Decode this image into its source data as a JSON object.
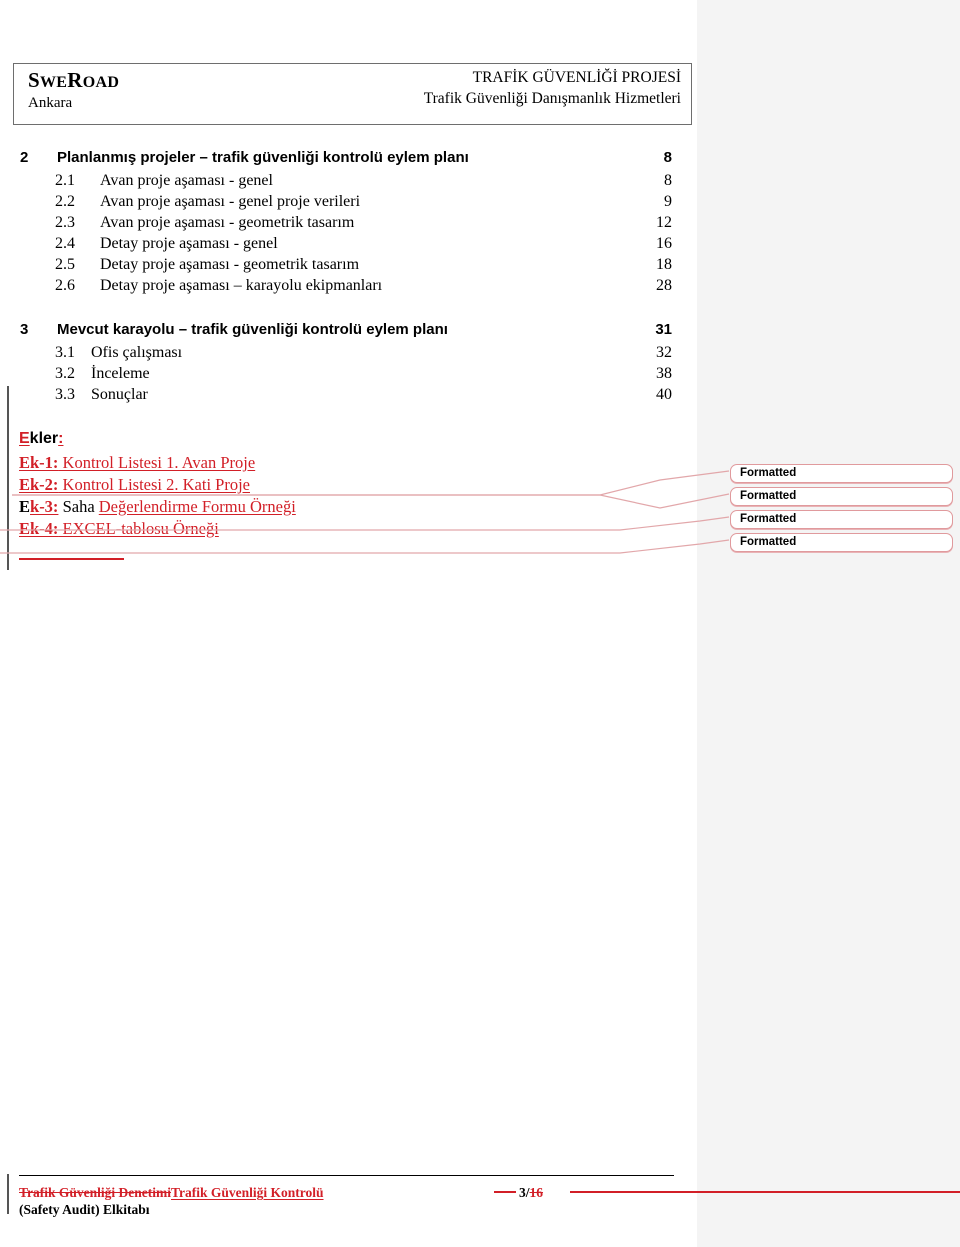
{
  "header": {
    "brand_lead": "S",
    "brand_rest_1": "WE",
    "brand_lead_2": "R",
    "brand_rest_2": "OAD",
    "city": "Ankara",
    "project_title": "TRAFİK GÜVENLİĞİ PROJESİ",
    "project_subtitle": "Trafik Güvenliği Danışmanlık Hizmetleri"
  },
  "toc": {
    "sections": [
      {
        "number": "2",
        "label": "Planlanmış projeler – trafik güvenliği kontrolü eylem planı",
        "page": "8",
        "entries": [
          {
            "number": "2.1",
            "label": "Avan proje aşaması - genel",
            "page": "8"
          },
          {
            "number": "2.2",
            "label": "Avan proje aşaması - genel proje verileri",
            "page": "9"
          },
          {
            "number": "2.3",
            "label": "Avan proje aşaması - geometrik tasarım",
            "page": "12"
          },
          {
            "number": "2.4",
            "label": "Detay proje aşaması - genel",
            "page": "16"
          },
          {
            "number": "2.5",
            "label": "Detay proje aşaması - geometrik tasarım",
            "page": "18"
          },
          {
            "number": "2.6",
            "label": "Detay proje aşaması – karayolu ekipmanları",
            "page": "28"
          }
        ]
      },
      {
        "number": "3",
        "label": "Mevcut karayolu – trafik güvenliği kontrolü eylem planı",
        "page": "31",
        "entries": [
          {
            "number": "3.1",
            "label": "Ofis çalışması",
            "page": "32"
          },
          {
            "number": "3.2",
            "label": "İnceleme",
            "page": "38"
          },
          {
            "number": "3.3",
            "label": "Sonuçlar",
            "page": "40"
          }
        ]
      }
    ]
  },
  "annexes": {
    "heading_inserted_first": "E",
    "heading_body": "kler",
    "heading_inserted_colon": ":",
    "items": [
      {
        "tag_inserted": "Ek-1:",
        "tag_black": "",
        "text_inserted": " Kontrol Listesi 1. Avan Proje",
        "text_black": ""
      },
      {
        "tag_inserted": "Ek-2:",
        "tag_black": "",
        "text_inserted": " Kontrol Listesi 2. Kati Proje",
        "text_black": ""
      },
      {
        "tag_black": "E",
        "tag_inserted": "k-3:",
        "text_black": " Saha ",
        "text_inserted": "Değerlendirme Formu Örneği"
      },
      {
        "tag_inserted": "Ek-4:",
        "tag_black": "",
        "text_inserted": " EXCEL-tablosu Örneği",
        "text_black": ""
      }
    ]
  },
  "comments": {
    "items": [
      {
        "label": "Formatted"
      },
      {
        "label": "Formatted"
      },
      {
        "label": "Formatted"
      },
      {
        "label": "Formatted"
      }
    ]
  },
  "footer": {
    "deleted_title": "Trafik Güvenliği Denetimi",
    "inserted_title": "Trafik Güvenliği Kontrolü",
    "second_line": "(Safety Audit) Elkitabı",
    "page_current": "3/",
    "page_total_deleted": "16"
  },
  "colors": {
    "insertion": "#d21f27",
    "deletion": "#d21f27",
    "callout_border": "#e09a9d",
    "change_bar": "#555555",
    "margin_background": "#f4f4f4"
  }
}
